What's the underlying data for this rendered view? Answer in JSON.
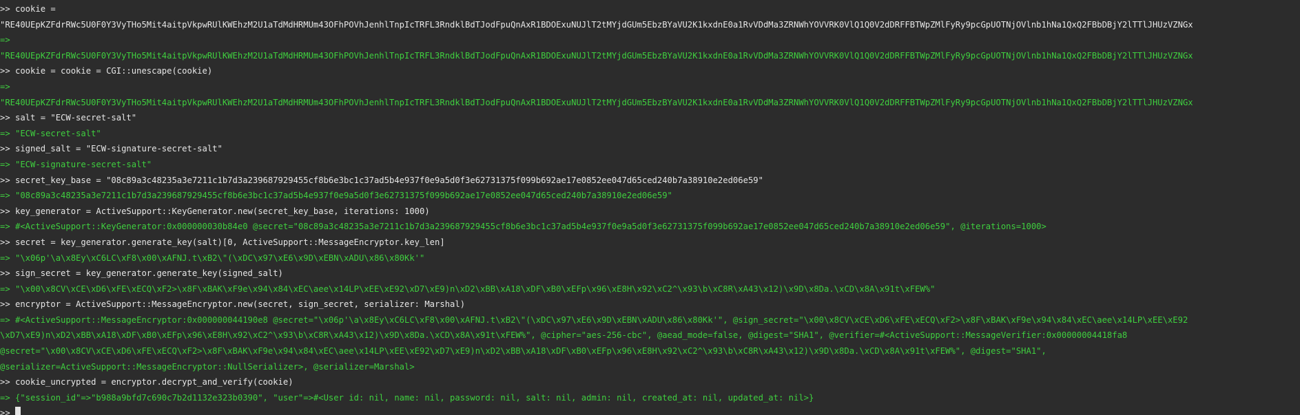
{
  "window": {
    "type": "terminal",
    "colors": {
      "background": "#2c2c2c",
      "command": "#e6e6e6",
      "output": "#3fcf3f"
    }
  },
  "lines": [
    {
      "kind": "cmd",
      "text": ">> cookie ="
    },
    {
      "kind": "cmd",
      "text": "\"RE40UEpKZFdrRWc5U0F0Y3VyTHo5Mit4aitpVkpwRUlKWEhzM2U1aTdMdHRMUm43OFhPOVhJenhlTnpIcTRFL3RndklBdTJodFpuQnAxR1BDOExuNUJlT2tMYjdGUm5EbzBYaVU2K1kxdnE0a1RvVDdMa3ZRNWhYOVVRK0VlQ1Q0V2dDRFFBTWpZMlFyRy9pcGpUOTNjOVlnb1hNa1QxQ2FBbDBjY2lTTlJHUzVZNGx"
    },
    {
      "kind": "out",
      "text": "=>"
    },
    {
      "kind": "out",
      "text": "\"RE40UEpKZFdrRWc5U0F0Y3VyTHo5Mit4aitpVkpwRUlKWEhzM2U1aTdMdHRMUm43OFhPOVhJenhlTnpIcTRFL3RndklBdTJodFpuQnAxR1BDOExuNUJlT2tMYjdGUm5EbzBYaVU2K1kxdnE0a1RvVDdMa3ZRNWhYOVVRK0VlQ1Q0V2dDRFFBTWpZMlFyRy9pcGpUOTNjOVlnb1hNa1QxQ2FBbDBjY2lTTlJHUzVZNGx"
    },
    {
      "kind": "cmd",
      "text": ">> cookie = cookie = CGI::unescape(cookie)"
    },
    {
      "kind": "out",
      "text": "=>"
    },
    {
      "kind": "out",
      "text": "\"RE40UEpKZFdrRWc5U0F0Y3VyTHo5Mit4aitpVkpwRUlKWEhzM2U1aTdMdHRMUm43OFhPOVhJenhlTnpIcTRFL3RndklBdTJodFpuQnAxR1BDOExuNUJlT2tMYjdGUm5EbzBYaVU2K1kxdnE0a1RvVDdMa3ZRNWhYOVVRK0VlQ1Q0V2dDRFFBTWpZMlFyRy9pcGpUOTNjOVlnb1hNa1QxQ2FBbDBjY2lTTlJHUzVZNGx"
    },
    {
      "kind": "cmd",
      "text": ">> salt = \"ECW-secret-salt\""
    },
    {
      "kind": "out",
      "text": "=> \"ECW-secret-salt\""
    },
    {
      "kind": "cmd",
      "text": ">> signed_salt = \"ECW-signature-secret-salt\""
    },
    {
      "kind": "out",
      "text": "=> \"ECW-signature-secret-salt\""
    },
    {
      "kind": "cmd",
      "text": ">> secret_key_base = \"08c89a3c48235a3e7211c1b7d3a239687929455cf8b6e3bc1c37ad5b4e937f0e9a5d0f3e62731375f099b692ae17e0852ee047d65ced240b7a38910e2ed06e59\""
    },
    {
      "kind": "out",
      "text": "=> \"08c89a3c48235a3e7211c1b7d3a239687929455cf8b6e3bc1c37ad5b4e937f0e9a5d0f3e62731375f099b692ae17e0852ee047d65ced240b7a38910e2ed06e59\""
    },
    {
      "kind": "cmd",
      "text": ">> key_generator = ActiveSupport::KeyGenerator.new(secret_key_base, iterations: 1000)"
    },
    {
      "kind": "out",
      "text": "=> #<ActiveSupport::KeyGenerator:0x000000030b84e0 @secret=\"08c89a3c48235a3e7211c1b7d3a239687929455cf8b6e3bc1c37ad5b4e937f0e9a5d0f3e62731375f099b692ae17e0852ee047d65ced240b7a38910e2ed06e59\", @iterations=1000>"
    },
    {
      "kind": "cmd",
      "text": ">> secret = key_generator.generate_key(salt)[0, ActiveSupport::MessageEncryptor.key_len]"
    },
    {
      "kind": "out",
      "text": "=> \"\\x06p'\\a\\x8Ey\\xC6LC\\xF8\\x00\\xAFNJ.t\\xB2\\\"(\\xDC\\x97\\xE6\\x9D\\xEBN\\xADU\\x86\\x80Kk'\""
    },
    {
      "kind": "cmd",
      "text": ">> sign_secret = key_generator.generate_key(signed_salt)"
    },
    {
      "kind": "out",
      "text": "=> \"\\x00\\x8CV\\xCE\\xD6\\xFE\\xECQ\\xF2>\\x8F\\xBAK\\xF9e\\x94\\x84\\xEC\\aee\\x14LP\\xEE\\xE92\\xD7\\xE9)n\\xD2\\xBB\\xA18\\xDF\\xB0\\xEFp\\x96\\xE8H\\x92\\xC2^\\x93\\b\\xC8R\\xA43\\x12)\\x9D\\x8Da.\\xCD\\x8A\\x91t\\xFEW%\""
    },
    {
      "kind": "cmd",
      "text": ">> encryptor = ActiveSupport::MessageEncryptor.new(secret, sign_secret, serializer: Marshal)"
    },
    {
      "kind": "out",
      "text": "=> #<ActiveSupport::MessageEncryptor:0x000000044190e8 @secret=\"\\x06p'\\a\\x8Ey\\xC6LC\\xF8\\x00\\xAFNJ.t\\xB2\\\"(\\xDC\\x97\\xE6\\x9D\\xEBN\\xADU\\x86\\x80Kk'\", @sign_secret=\"\\x00\\x8CV\\xCE\\xD6\\xFE\\xECQ\\xF2>\\x8F\\xBAK\\xF9e\\x94\\x84\\xEC\\aee\\x14LP\\xEE\\xE92"
    },
    {
      "kind": "out",
      "text": "\\xD7\\xE9)n\\xD2\\xBB\\xA18\\xDF\\xB0\\xEFp\\x96\\xE8H\\x92\\xC2^\\x93\\b\\xC8R\\xA43\\x12)\\x9D\\x8Da.\\xCD\\x8A\\x91t\\xFEW%\", @cipher=\"aes-256-cbc\", @aead_mode=false, @digest=\"SHA1\", @verifier=#<ActiveSupport::MessageVerifier:0x00000004418fa8"
    },
    {
      "kind": "out",
      "text": "@secret=\"\\x00\\x8CV\\xCE\\xD6\\xFE\\xECQ\\xF2>\\x8F\\xBAK\\xF9e\\x94\\x84\\xEC\\aee\\x14LP\\xEE\\xE92\\xD7\\xE9)n\\xD2\\xBB\\xA18\\xDF\\xB0\\xEFp\\x96\\xE8H\\x92\\xC2^\\x93\\b\\xC8R\\xA43\\x12)\\x9D\\x8Da.\\xCD\\x8A\\x91t\\xFEW%\", @digest=\"SHA1\","
    },
    {
      "kind": "out",
      "text": "@serializer=ActiveSupport::MessageEncryptor::NullSerializer>, @serializer=Marshal>"
    },
    {
      "kind": "cmd",
      "text": ">> cookie_uncrypted = encryptor.decrypt_and_verify(cookie)"
    },
    {
      "kind": "out",
      "text": "=> {\"session_id\"=>\"b988a9bfd7c690c7b2d1132e323b0390\", \"user\"=>#<User id: nil, name: nil, password: nil, salt: nil, admin: nil, created_at: nil, updated_at: nil>}"
    }
  ],
  "prompt": {
    "text": ">> "
  }
}
